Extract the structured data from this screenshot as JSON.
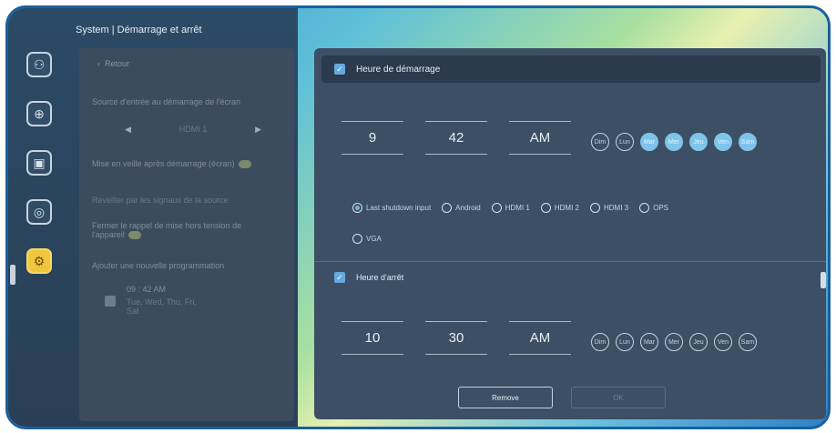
{
  "title": "System | Démarrage et arrêt",
  "nav": [
    {
      "icon": "user-icon",
      "glyph": "⚇"
    },
    {
      "icon": "globe-icon",
      "glyph": "⊕"
    },
    {
      "icon": "display-settings-icon",
      "glyph": "▣"
    },
    {
      "icon": "shield-icon",
      "glyph": "◎"
    },
    {
      "icon": "gear-icon",
      "glyph": "⚙"
    }
  ],
  "sub_panel": {
    "back_label": "Retour",
    "source_label": "Source d'entrée au démarrage de l'écran",
    "source_value": "HDMI 1",
    "standby_label": "Mise en veille après démarrage (écran)",
    "standby_value": "ON",
    "wake_label": "Réveiller par les signaux de la source",
    "close_label": "Fermer le rappel de mise hors tension de l'appareil",
    "add_label": "Ajouter une nouvelle programmation",
    "schedule_time": "09 : 42 AM",
    "schedule_days": "Tue, Wed, Thu, Fri, Sat"
  },
  "start": {
    "header": "Heure de démarrage",
    "hour": "9",
    "minute": "42",
    "ampm": "AM",
    "days": [
      {
        "label": "Dim",
        "on": false
      },
      {
        "label": "Lun",
        "on": false
      },
      {
        "label": "Mar",
        "on": true
      },
      {
        "label": "Mer",
        "on": true
      },
      {
        "label": "Jeu",
        "on": true
      },
      {
        "label": "Ven",
        "on": true
      },
      {
        "label": "Sam",
        "on": true
      }
    ],
    "inputs": [
      "Last shutdown input",
      "Android",
      "HDMI 1",
      "HDMI 2",
      "HDMI 3",
      "OPS",
      "VGA"
    ],
    "selected_input": "Last shutdown input"
  },
  "stop": {
    "header": "Heure d'arrêt",
    "hour": "10",
    "minute": "30",
    "ampm": "AM",
    "days": [
      {
        "label": "Dim",
        "on": false
      },
      {
        "label": "Lun",
        "on": false
      },
      {
        "label": "Mar",
        "on": false
      },
      {
        "label": "Mer",
        "on": false
      },
      {
        "label": "Jeu",
        "on": false
      },
      {
        "label": "Ven",
        "on": false
      },
      {
        "label": "Sam",
        "on": false
      }
    ]
  },
  "buttons": {
    "remove": "Remove",
    "ok": "OK"
  }
}
